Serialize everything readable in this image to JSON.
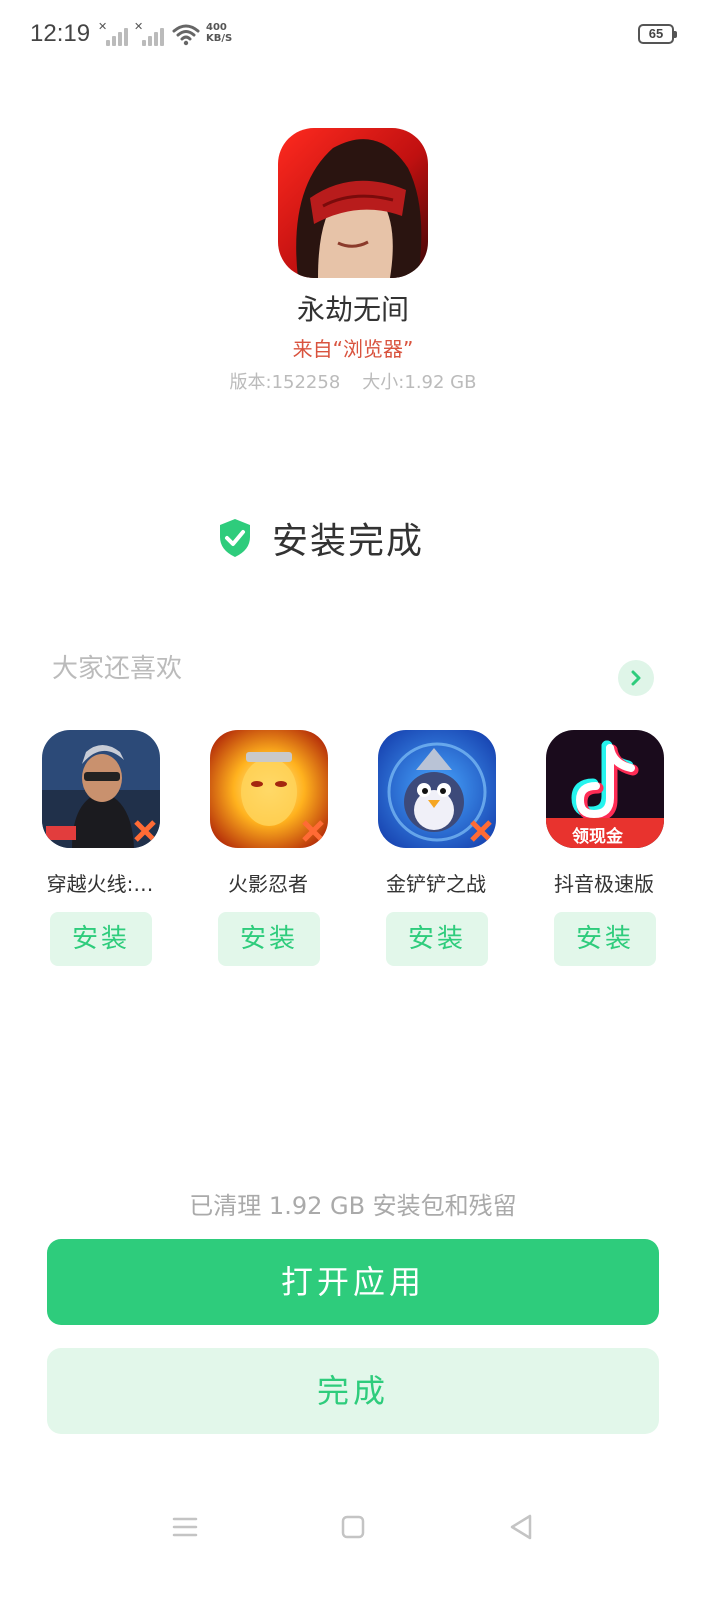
{
  "status_bar": {
    "time": "12:19",
    "net_speed_value": "400",
    "net_speed_unit": "KB/S",
    "battery": "65"
  },
  "app": {
    "name": "永劫无间",
    "source": "来自“浏览器”",
    "version": "版本:152258",
    "size": "大小:1.92 GB"
  },
  "install_state": {
    "text": "安装完成"
  },
  "recommendations": {
    "title": "大家还喜欢",
    "items": [
      {
        "name": "穿越火线:…",
        "install_label": "安装"
      },
      {
        "name": "火影忍者",
        "install_label": "安装"
      },
      {
        "name": "金铲铲之战",
        "install_label": "安装"
      },
      {
        "name": "抖音极速版",
        "install_label": "安装",
        "badge": "领现金"
      }
    ]
  },
  "cleanup_note": "已清理 1.92 GB 安装包和残留",
  "buttons": {
    "open": "打开应用",
    "done": "完成"
  },
  "colors": {
    "accent": "#2ecc7c",
    "accent_light": "#e2f7ea",
    "source_red": "#d9533e"
  }
}
